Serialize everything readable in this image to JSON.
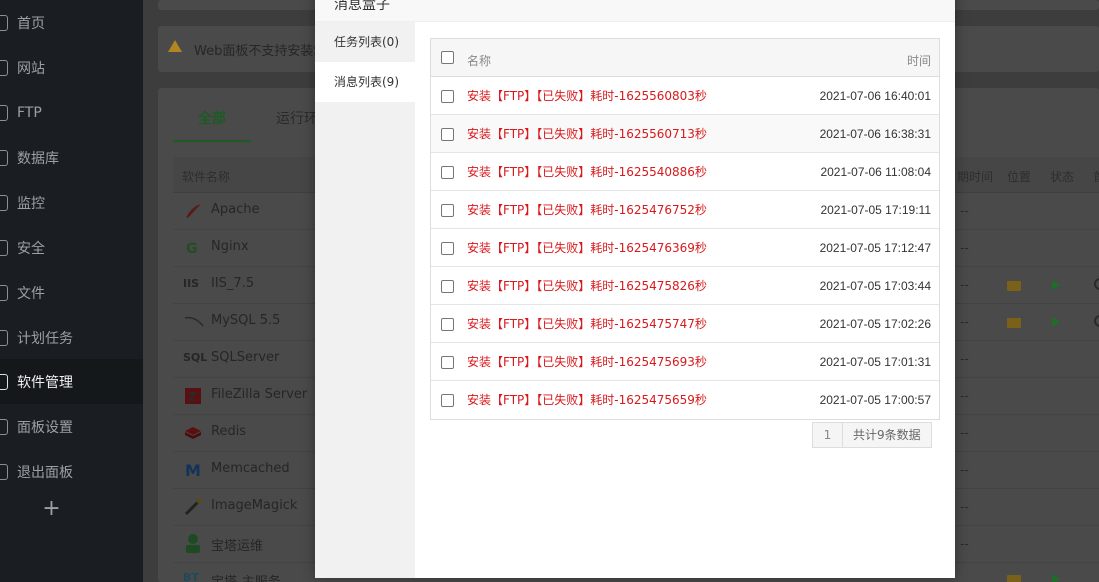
{
  "sidebar": {
    "items": [
      {
        "label": "首页",
        "active": false
      },
      {
        "label": "网站",
        "active": false
      },
      {
        "label": "FTP",
        "active": false
      },
      {
        "label": "数据库",
        "active": false
      },
      {
        "label": "监控",
        "active": false
      },
      {
        "label": "安全",
        "active": false
      },
      {
        "label": "文件",
        "active": false
      },
      {
        "label": "计划任务",
        "active": false
      },
      {
        "label": "软件管理",
        "active": true
      },
      {
        "label": "面板设置",
        "active": false
      },
      {
        "label": "退出面板",
        "active": false
      }
    ],
    "add_label": "+"
  },
  "background": {
    "warning_text": "Web面板不支持安装SC",
    "tabs": [
      "全部",
      "运行环"
    ],
    "table_headers": {
      "name": "软件名称",
      "expire": "期时间",
      "location": "位置",
      "status": "状态",
      "first": "首"
    },
    "software": [
      {
        "name": "Apache",
        "icon": "apache-feather-icon",
        "dash": "--"
      },
      {
        "name": "Nginx",
        "icon": "nginx-icon",
        "dash": "--"
      },
      {
        "name": "IIS_7.5",
        "icon": "iis-icon",
        "dash": "--"
      },
      {
        "name": "MySQL 5.5",
        "icon": "mysql-dolphin-icon",
        "dash": "--"
      },
      {
        "name": "SQLServer",
        "icon": "sql-icon",
        "dash": "--"
      },
      {
        "name": "FileZilla Server",
        "icon": "filezilla-icon",
        "dash": "--"
      },
      {
        "name": "Redis",
        "icon": "redis-icon",
        "dash": "--"
      },
      {
        "name": "Memcached",
        "icon": "memcached-icon",
        "dash": "--"
      },
      {
        "name": "ImageMagick",
        "icon": "imagemagick-wand-icon",
        "dash": "--"
      },
      {
        "name": "宝塔运维",
        "icon": "bt-ops-icon",
        "dash": "--"
      },
      {
        "name": "宝塔-主服务",
        "icon": "bt-icon",
        "dash": ""
      }
    ]
  },
  "modal": {
    "title": "消息盒子",
    "left_tabs": [
      {
        "label": "任务列表(0)",
        "active": false
      },
      {
        "label": "消息列表(9)",
        "active": true
      }
    ],
    "table": {
      "col_name": "名称",
      "col_time": "时间",
      "rows": [
        {
          "text": "安装【FTP】【已失败】耗时-1625560803秒",
          "time": "2021-07-06 16:40:01"
        },
        {
          "text": "安装【FTP】【已失败】耗时-1625560713秒",
          "time": "2021-07-06 16:38:31"
        },
        {
          "text": "安装【FTP】【已失败】耗时-1625540886秒",
          "time": "2021-07-06 11:08:04"
        },
        {
          "text": "安装【FTP】【已失败】耗时-1625476752秒",
          "time": "2021-07-05 17:19:11"
        },
        {
          "text": "安装【FTP】【已失败】耗时-1625476369秒",
          "time": "2021-07-05 17:12:47"
        },
        {
          "text": "安装【FTP】【已失败】耗时-1625475826秒",
          "time": "2021-07-05 17:03:44"
        },
        {
          "text": "安装【FTP】【已失败】耗时-1625475747秒",
          "time": "2021-07-05 17:02:26"
        },
        {
          "text": "安装【FTP】【已失败】耗时-1625475693秒",
          "time": "2021-07-05 17:01:31"
        },
        {
          "text": "安装【FTP】【已失败】耗时-1625475659秒",
          "time": "2021-07-05 17:00:57"
        }
      ]
    },
    "pager": {
      "page": "1",
      "total": "共计9条数据"
    }
  },
  "colors": {
    "fail_text": "#d9191c",
    "accent": "#20a53a"
  }
}
